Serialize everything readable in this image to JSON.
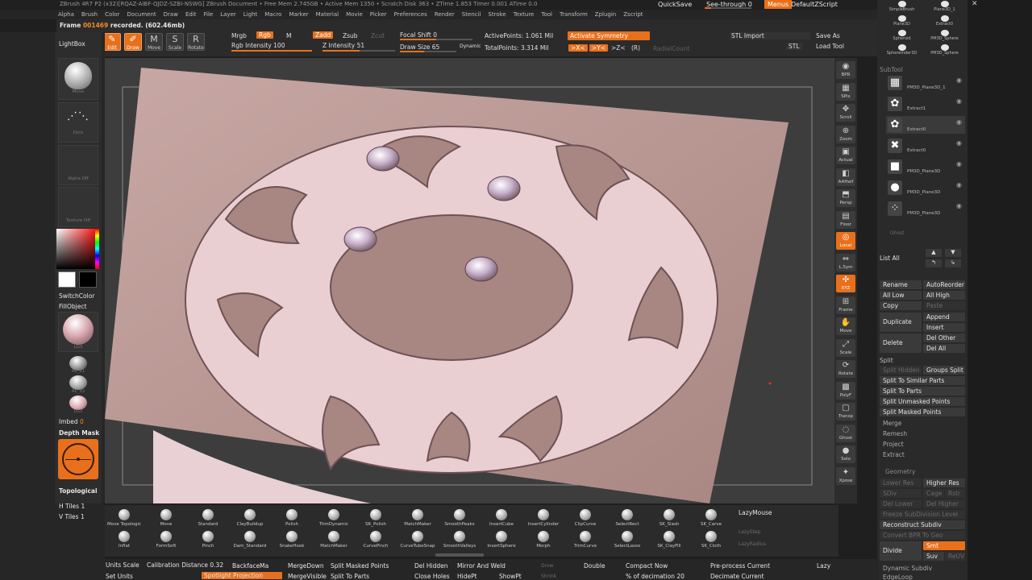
{
  "window": {
    "title_line": "ZBrush 4R7 P2 (x32)[RQAZ-AIBF-QJDZ-SZBI-NSWG]  ZBrush Document  • Free Mem 2.745GB • Active Mem 1350 • Scratch Disk 363 • ZTime 1.853 Timer 0.001 ATime 0.0",
    "quicksave": "QuickSave",
    "see_through": "See-through",
    "see_through_value": "0",
    "menus": "Menus",
    "default_zscript": "DefaultZScript"
  },
  "menus": [
    "Alpha",
    "Brush",
    "Color",
    "Document",
    "Draw",
    "Edit",
    "File",
    "Layer",
    "Light",
    "Macro",
    "Marker",
    "Material",
    "Movie",
    "Picker",
    "Preferences",
    "Render",
    "Stencil",
    "Stroke",
    "Texture",
    "Tool",
    "Transform",
    "Zplugin",
    "Zscript"
  ],
  "top_shelf": {
    "frame_label": "Frame",
    "frame_value": "001469",
    "frame_status": "recorded. (602.46mb)",
    "modes": [
      {
        "icon": "pencil-icon",
        "glyph": "✎",
        "label": "Edit",
        "on": true
      },
      {
        "icon": "draw-icon",
        "glyph": "✐",
        "label": "Draw",
        "on": true
      },
      {
        "icon": "move-icon",
        "glyph": "M",
        "label": "Move",
        "on": false
      },
      {
        "icon": "scale-icon",
        "glyph": "S",
        "label": "Scale",
        "on": false
      },
      {
        "icon": "rotate-icon",
        "glyph": "R",
        "label": "Rotate",
        "on": false
      }
    ],
    "mrgb": "Mrgb",
    "rgb": "Rgb",
    "m": "M",
    "zadd": "Zadd",
    "zsub": "Zsub",
    "zcut": "Zcut",
    "rgb_intensity_label": "Rgb Intensity",
    "rgb_intensity_value": "100",
    "z_intensity_label": "Z Intensity",
    "z_intensity_value": "51",
    "focal_shift_label": "Focal Shift",
    "focal_shift_value": "0",
    "draw_size_label": "Draw Size",
    "draw_size_value": "65",
    "dynamic": "Dynamic",
    "active_points_label": "ActivePoints:",
    "active_points_value": "1.061 Mil",
    "total_points_label": "TotalPoints:",
    "total_points_value": "3.314 Mil",
    "activate_symmetry": "Activate Symmetry",
    "sym_x": ">X<",
    "sym_y": ">Y<",
    "sym_z": ">Z<",
    "sym_r": "(R)",
    "radial_count": "RadialCount",
    "stl_import": "STL Import",
    "stl": "STL",
    "save_as": "Save As",
    "load_tool": "Load Tool"
  },
  "left_tray": {
    "lightbox": "LightBox",
    "move_cap": "Move",
    "dots_cap": "Dots",
    "alpha_cap": "Alpha Off",
    "texture_cap": "Texture Off",
    "switch_color": "SwitchColor",
    "fill_object": "FillObject",
    "mat_cap": "LG3",
    "al_caps": [
      "AL_21",
      "AL_32",
      "LG3"
    ],
    "imbed_label": "Imbed",
    "imbed_value": "0",
    "depth_mask": "Depth Mask",
    "topological": "Topological",
    "h_tiles": "H Tiles 1",
    "v_tiles": "V Tiles 1",
    "colors": {
      "accent": "#e8701c",
      "primary_color": "#ffffff",
      "secondary_color": "#000000"
    }
  },
  "right_shelf": [
    {
      "icon": "bpr-icon",
      "glyph": "◉",
      "label": "BPR"
    },
    {
      "icon": "spix-icon",
      "glyph": "▦",
      "label": "SPix"
    },
    {
      "icon": "scroll-icon",
      "glyph": "✥",
      "label": "Scroll"
    },
    {
      "icon": "zoom-icon",
      "glyph": "⊕",
      "label": "Zoom"
    },
    {
      "icon": "actual-icon",
      "glyph": "▣",
      "label": "Actual"
    },
    {
      "icon": "aahalf-icon",
      "glyph": "◧",
      "label": "AAHalf"
    },
    {
      "icon": "persp-icon",
      "glyph": "⬒",
      "label": "Persp"
    },
    {
      "icon": "floor-icon",
      "glyph": "▤",
      "label": "Floor"
    },
    {
      "icon": "local-icon",
      "glyph": "◎",
      "label": "Local",
      "on": true
    },
    {
      "icon": "lsym-icon",
      "glyph": "⇔",
      "label": "L.Sym"
    },
    {
      "icon": "xyz-icon",
      "glyph": "✣",
      "label": "XYZ",
      "on": true
    },
    {
      "icon": "frame-icon",
      "glyph": "⊞",
      "label": "Frame"
    },
    {
      "icon": "move-view-icon",
      "glyph": "✋",
      "label": "Move"
    },
    {
      "icon": "scale-view-icon",
      "glyph": "⤢",
      "label": "Scale"
    },
    {
      "icon": "rotate-view-icon",
      "glyph": "⟳",
      "label": "Rotate"
    },
    {
      "icon": "polyf-icon",
      "glyph": "▩",
      "label": "PolyF"
    },
    {
      "icon": "transp-icon",
      "glyph": "▢",
      "label": "Transp"
    },
    {
      "icon": "ghost-icon",
      "glyph": "◌",
      "label": "Ghost"
    },
    {
      "icon": "solo-icon",
      "glyph": "●",
      "label": "Solo"
    },
    {
      "icon": "xpose-icon",
      "glyph": "✦",
      "label": "Xpose"
    }
  ],
  "tool_palette": {
    "top_thumbs": [
      "SimpleBrush",
      "Plane3D_1",
      "Plane3D",
      "Extract0",
      "Spheroid",
      "PM3D_Sphere",
      "Sphereinder3D",
      "PM3D_Sphere"
    ],
    "subtool_header": "SubTool",
    "subtools": [
      "PM3D_Plane3D_1",
      "Extract1",
      "Extract0",
      "Extract0",
      "PM3D_Plane3D",
      "PM3D_Plane3D",
      "PM3D_Plane3D"
    ],
    "dimmed": "Ghost",
    "list_all": "List All",
    "rename": "Rename",
    "auto_reorder": "AutoReorder",
    "all_low": "All Low",
    "all_high": "All High",
    "copy": "Copy",
    "paste": "Paste",
    "duplicate": "Duplicate",
    "append": "Append",
    "insert": "Insert",
    "delete": "Delete",
    "del_other": "Del Other",
    "del_all": "Del All",
    "split_header": "Split",
    "split_hidden": "Split Hidden",
    "groups_split": "Groups Split",
    "split_similar": "Split To Similar Parts",
    "split_parts": "Split To Parts",
    "split_unmasked": "Split Unmasked Points",
    "split_masked": "Split Masked Points",
    "merge": "Merge",
    "remesh": "Remesh",
    "project": "Project",
    "extract": "Extract",
    "geometry_header": "Geometry",
    "lower_res": "Lower Res",
    "higher_res": "Higher Res",
    "sdiv": "SDiv",
    "cage": "Cage",
    "rstr": "Rstr",
    "del_lower": "Del Lower",
    "del_higher": "Del Higher",
    "freeze_subdivision": "Freeze SubDivision Level",
    "reconstruct_subdiv": "Reconstruct Subdiv",
    "convert_bpr": "Convert BPR To Geo",
    "divide": "Divide",
    "smt": "Smt",
    "suv": "Suv",
    "reuv": "ReUV",
    "dynamic_subdiv": "Dynamic Subdiv",
    "edge_loop": "EdgeLoop"
  },
  "brushes": {
    "row1": [
      "Move Topologic",
      "Move",
      "Standard",
      "ClayBuildup",
      "Polish",
      "TrimDynamic",
      "SK_Polish",
      "MatchMaker",
      "SmoothPeaks",
      "InsertCube",
      "InsertCylinder",
      "ClipCurve",
      "SelectRect",
      "SK_Slash",
      "SK_Carve"
    ],
    "row2": [
      "Inflat",
      "FormSoft",
      "Pinch",
      "Dam_Standard",
      "SnakeHook",
      "MatchMaker",
      "CurvePinch",
      "CurveTubeSnap",
      "SmoothValleys",
      "InsertSphere",
      "Morph",
      "TrimCurve",
      "SelectLasso",
      "SK_ClayFill",
      "SK_Cloth"
    ],
    "lazy_mouse": "LazyMouse",
    "lazy_step": "LazyStep",
    "lazy_radius": "LazyRadius"
  },
  "bottom_bar": {
    "units_scale": "Units Scale",
    "calibration_distance_label": "Calibration Distance",
    "calibration_distance_value": "0.32",
    "backface_mask": "BackfaceMa",
    "set_units": "Set Units",
    "spotlight_projection": "Spotlight Projection",
    "merge_down": "MergeDown",
    "merge_visible": "MergeVisible",
    "split_masked_points": "Split Masked Points",
    "split_to_parts": "Split To Parts",
    "del_hidden": "Del Hidden",
    "close_holes": "Close Holes",
    "mirror_and_weld": "Mirror And Weld",
    "hidept": "HidePt",
    "showpt": "ShowPt",
    "grow": "Grow",
    "shrink": "Shrink",
    "double": "Double",
    "compact_now": "Compact Now",
    "pct_decimation_label": "% of decimation",
    "pct_decimation_value": "20",
    "preprocess_current": "Pre-process Current",
    "decimate_current": "Decimate Current",
    "lazy": "Lazy"
  }
}
